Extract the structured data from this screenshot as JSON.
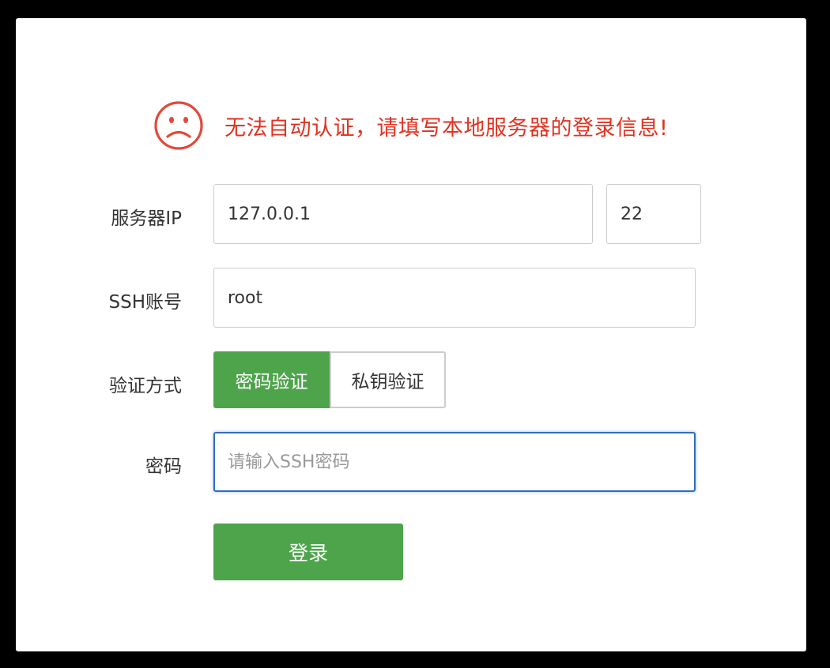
{
  "alert": {
    "icon": "sad-face-icon",
    "message": "无法自动认证，请填写本地服务器的登录信息!",
    "color": "#e03322"
  },
  "form": {
    "server_ip": {
      "label": "服务器IP",
      "value": "127.0.0.1",
      "port_value": "22"
    },
    "ssh_account": {
      "label": "SSH账号",
      "value": "root"
    },
    "auth_method": {
      "label": "验证方式",
      "options": [
        "密码验证",
        "私钥验证"
      ],
      "selected": "密码验证"
    },
    "password": {
      "label": "密码",
      "placeholder": "请输入SSH密码",
      "value": ""
    },
    "submit_label": "登录"
  },
  "colors": {
    "accent": "#4ea44b",
    "focus": "#2f6ebe",
    "error": "#e03322"
  }
}
